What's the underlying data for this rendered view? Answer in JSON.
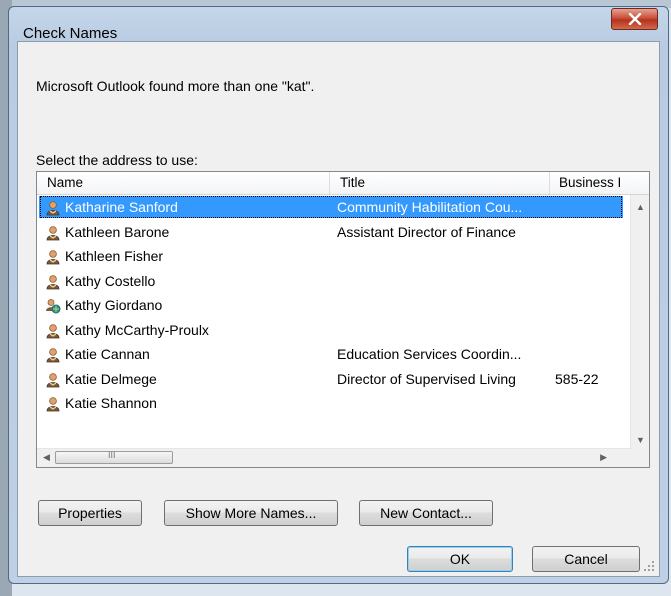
{
  "dialog": {
    "title": "Check Names",
    "message": "Microsoft Outlook found more than one \"kat\".",
    "select_label": "Select the address to use:"
  },
  "columns": [
    "Name",
    "Title",
    "Business I"
  ],
  "rows": [
    {
      "name": "Katharine Sanford",
      "title": "Community Habilitation Cou...",
      "business": "",
      "icon": "person-icon",
      "selected": true
    },
    {
      "name": "Kathleen Barone",
      "title": "Assistant Director of Finance",
      "business": "",
      "icon": "person-icon"
    },
    {
      "name": "Kathleen Fisher",
      "title": "",
      "business": "",
      "icon": "person-icon"
    },
    {
      "name": "Kathy Costello",
      "title": "",
      "business": "",
      "icon": "person-icon"
    },
    {
      "name": "Kathy Giordano",
      "title": "",
      "business": "",
      "icon": "contact-globe-icon"
    },
    {
      "name": "Kathy McCarthy-Proulx",
      "title": "",
      "business": "",
      "icon": "person-icon"
    },
    {
      "name": "Katie Cannan",
      "title": "Education Services Coordin...",
      "business": "",
      "icon": "person-icon"
    },
    {
      "name": "Katie Delmege",
      "title": "Director of Supervised Living",
      "business": "585-22",
      "icon": "person-icon"
    },
    {
      "name": "Katie Shannon",
      "title": "",
      "business": "",
      "icon": "person-icon"
    }
  ],
  "scroll": {
    "h_thumb_marks": "III"
  },
  "buttons": {
    "properties": "Properties",
    "show_more": "Show More Names...",
    "new_contact": "New Contact...",
    "ok": "OK",
    "cancel": "Cancel",
    "close": "X"
  },
  "colors": {
    "selection": "#3399ff",
    "close": "#c9503a"
  }
}
